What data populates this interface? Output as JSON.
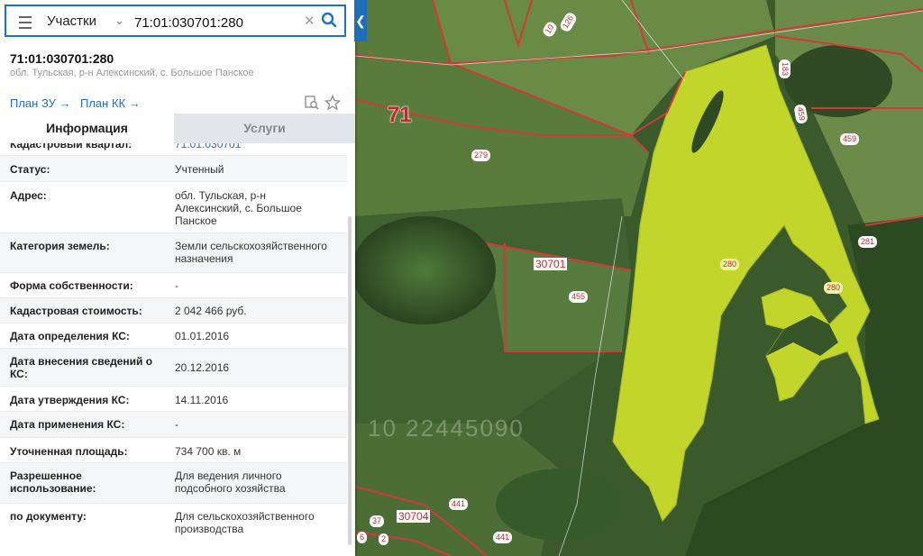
{
  "search": {
    "layer_label": "Участки",
    "value": "71:01:030701:280"
  },
  "parcel": {
    "title": "71:01:030701:280",
    "subtitle": "обл. Тульская, р-н Алексинский, с. Большое Панское",
    "plan_zu": "План ЗУ",
    "plan_kk": "План КК"
  },
  "tabs": {
    "info": "Информация",
    "services": "Услуги"
  },
  "rows": [
    {
      "label": "Кадастровый квартал:",
      "value": "71:01:030701"
    },
    {
      "label": "Статус:",
      "value": "Учтенный"
    },
    {
      "label": "Адрес:",
      "value": "обл. Тульская, р-н Алексинский, с. Большое Панское"
    },
    {
      "label": "Категория земель:",
      "value": "Земли сельскохозяйственного назначения"
    },
    {
      "label": "Форма собственности:",
      "value": "-"
    },
    {
      "label": "Кадастровая стоимость:",
      "value": "2 042 466 руб."
    },
    {
      "label": "Дата определения КС:",
      "value": "01.01.2016"
    },
    {
      "label": "Дата внесения сведений о КС:",
      "value": "20.12.2016"
    },
    {
      "label": "Дата утверждения КС:",
      "value": "14.11.2016"
    },
    {
      "label": "Дата применения КС:",
      "value": "-"
    },
    {
      "label": "Уточненная площадь:",
      "value": "734 700 кв. м"
    },
    {
      "label": "Разрешенное использование:",
      "value": "Для ведения личного подсобного хозяйства"
    },
    {
      "label": "по документу:",
      "value": "Для сельскохозяйственного производства"
    }
  ],
  "map": {
    "district_label": "71",
    "quarter_label": "30701",
    "quarter_label_2": "30704",
    "parcel_labels": [
      "280",
      "280",
      "279",
      "455",
      "459",
      "281",
      "183",
      "459",
      "10",
      "126",
      "441",
      "441",
      "37",
      "2",
      "6"
    ],
    "watermark": "10 22445090",
    "highlight_color": "#d4e62a",
    "boundary_color": "#d23a3a"
  },
  "colors": {
    "accent": "#1e73be"
  }
}
